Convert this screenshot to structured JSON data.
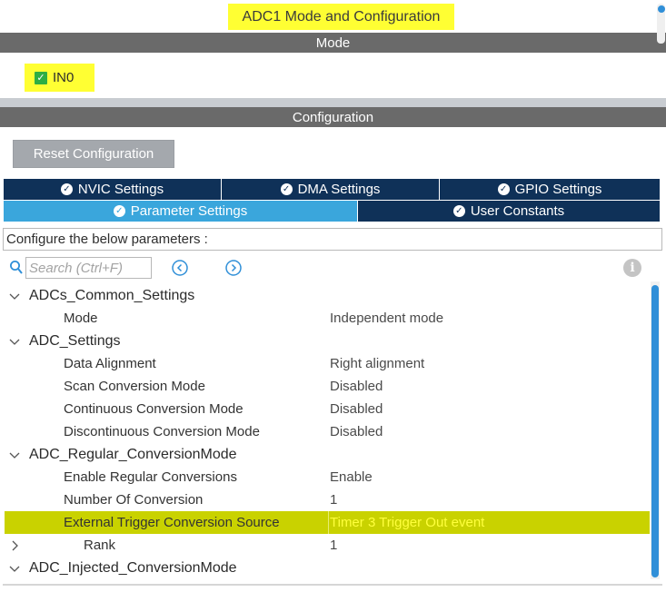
{
  "window_title": "ADC1 Mode and Configuration",
  "mode_section": {
    "label": "Mode",
    "items": [
      {
        "label": "IN0",
        "checked": true
      }
    ]
  },
  "config_section": {
    "label": "Configuration"
  },
  "reset_button": {
    "label": "Reset Configuration"
  },
  "tabs": [
    {
      "label": "NVIC Settings",
      "active": false
    },
    {
      "label": "DMA Settings",
      "active": false
    },
    {
      "label": "GPIO Settings",
      "active": false
    },
    {
      "label": "Parameter Settings",
      "active": true
    },
    {
      "label": "User Constants",
      "active": false
    }
  ],
  "params_header": "Configure the below parameters :",
  "search": {
    "placeholder": "Search (Ctrl+F)"
  },
  "tree": [
    {
      "type": "group",
      "label": "ADCs_Common_Settings",
      "expanded": true
    },
    {
      "type": "param",
      "label": "Mode",
      "value": "Independent mode"
    },
    {
      "type": "group",
      "label": "ADC_Settings",
      "expanded": true
    },
    {
      "type": "param",
      "label": "Data Alignment",
      "value": "Right alignment"
    },
    {
      "type": "param",
      "label": "Scan Conversion Mode",
      "value": "Disabled"
    },
    {
      "type": "param",
      "label": "Continuous Conversion Mode",
      "value": "Disabled"
    },
    {
      "type": "param",
      "label": "Discontinuous Conversion Mode",
      "value": "Disabled"
    },
    {
      "type": "group",
      "label": "ADC_Regular_ConversionMode",
      "expanded": true
    },
    {
      "type": "param",
      "label": "Enable Regular Conversions",
      "value": "Enable"
    },
    {
      "type": "param",
      "label": "Number Of Conversion",
      "value": "1"
    },
    {
      "type": "param",
      "label": "External Trigger Conversion Source",
      "value": "Timer 3 Trigger Out event",
      "highlighted": true
    },
    {
      "type": "subgroup",
      "label": "Rank",
      "value": "1",
      "expanded": false
    },
    {
      "type": "group",
      "label": "ADC_Injected_ConversionMode",
      "expanded": true
    }
  ],
  "colors": {
    "highlight_yellow": "#ffff33",
    "highlight_row": "#c9d200",
    "tab_dark": "#0f3158",
    "tab_active": "#3aa6dc",
    "section_bar": "#6a6a6a",
    "check_green": "#2fae44"
  },
  "icons": {
    "search": "search-icon",
    "prev": "arrow-left-circle-icon",
    "next": "arrow-right-circle-icon",
    "info": "info-icon",
    "expand": "chevron-down-icon",
    "collapse": "chevron-right-icon"
  }
}
